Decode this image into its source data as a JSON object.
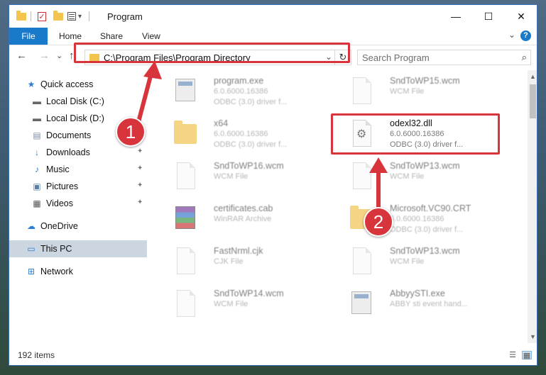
{
  "window": {
    "title": "Program",
    "quick_access_dropdown": "▾",
    "minimize": "—",
    "maximize": "☐",
    "close": "✕"
  },
  "ribbon": {
    "tabs": [
      "File",
      "Home",
      "Share",
      "View"
    ],
    "expand": "⌄",
    "help": "?"
  },
  "nav": {
    "back": "←",
    "forward": "→",
    "recent": "⌄",
    "up": "↑",
    "address": "C:\\Program Files\\Program Directory",
    "address_dropdown": "⌄",
    "refresh": "↻",
    "search_placeholder": "Search Program"
  },
  "sidebar": {
    "items": [
      {
        "label": "Quick access",
        "icon": "star-icon",
        "pinned": false
      },
      {
        "label": "Local Disk (C:)",
        "icon": "drive-icon",
        "pinned": false
      },
      {
        "label": "Local Disk (D:)",
        "icon": "drive-icon",
        "pinned": false
      },
      {
        "label": "Documents",
        "icon": "documents-icon",
        "pinned": true
      },
      {
        "label": "Downloads",
        "icon": "download-icon",
        "pinned": true
      },
      {
        "label": "Music",
        "icon": "music-icon",
        "pinned": true
      },
      {
        "label": "Pictures",
        "icon": "pictures-icon",
        "pinned": true
      },
      {
        "label": "Videos",
        "icon": "videos-icon",
        "pinned": true
      },
      {
        "label": "OneDrive",
        "icon": "cloud-icon",
        "pinned": false
      },
      {
        "label": "This PC",
        "icon": "computer-icon",
        "pinned": false,
        "selected": true
      },
      {
        "label": "Network",
        "icon": "network-icon",
        "pinned": false
      }
    ],
    "pin_glyph": "📌"
  },
  "files": [
    {
      "name": "program.exe",
      "line1": "6.0.6000.16386",
      "line2": "ODBC (3.0) driver f...",
      "kind": "exe"
    },
    {
      "name": "SndToWP15.wcm",
      "line1": "WCM File",
      "line2": "",
      "kind": "doc"
    },
    {
      "name": "x64",
      "line1": "6.0.6000.16386",
      "line2": "ODBC (3.0) driver f...",
      "kind": "folder"
    },
    {
      "name": "odexl32.dll",
      "line1": "6.0.6000.16386",
      "line2": "ODBC (3.0) driver f...",
      "kind": "dll"
    },
    {
      "name": "SndToWP16.wcm",
      "line1": "WCM File",
      "line2": "",
      "kind": "doc"
    },
    {
      "name": "SndToWP13.wcm",
      "line1": "WCM File",
      "line2": "",
      "kind": "doc"
    },
    {
      "name": "certificates.cab",
      "line1": "WinRAR Archive",
      "line2": "",
      "kind": "rar"
    },
    {
      "name": "Microsoft.VC90.CRT",
      "line1": "6.0.6000.16386",
      "line2": "ODBC (3.0) driver f...",
      "kind": "folder"
    },
    {
      "name": "FastNrml.cjk",
      "line1": "CJK File",
      "line2": "",
      "kind": "doc"
    },
    {
      "name": "SndToWP13.wcm",
      "line1": "WCM File",
      "line2": "",
      "kind": "doc"
    },
    {
      "name": "SndToWP14.wcm",
      "line1": "WCM File",
      "line2": "",
      "kind": "doc"
    },
    {
      "name": "AbbyySTI.exe",
      "line1": "ABBY sti event hand...",
      "line2": "",
      "kind": "exe"
    }
  ],
  "highlighted_file": "odexl32.dll",
  "status": {
    "item_count": "192 items"
  },
  "callouts": [
    "1",
    "2"
  ],
  "colors": {
    "accent": "#1979ca",
    "highlight_red": "#d8343b",
    "selected_bg": "#ccd6e1",
    "folder": "#f3c54e"
  }
}
